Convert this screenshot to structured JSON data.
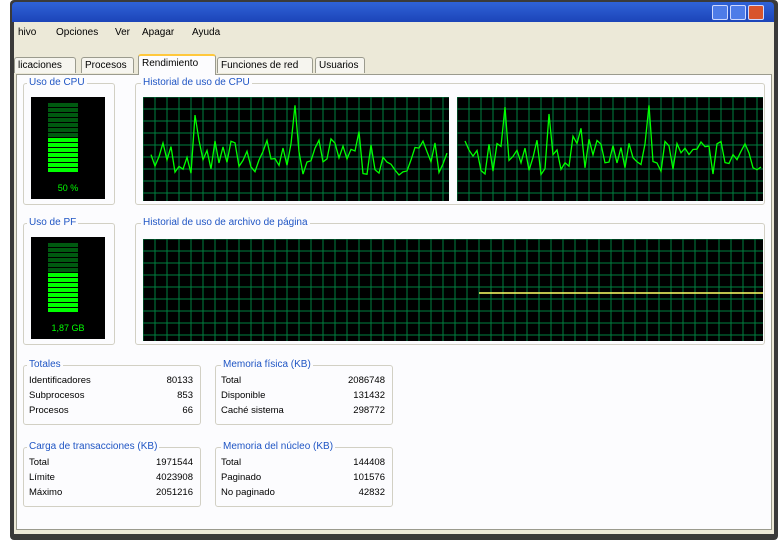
{
  "menu": [
    {
      "label": "hivo"
    },
    {
      "label": "Opciones"
    },
    {
      "label": "Ver"
    },
    {
      "label": "Apagar"
    },
    {
      "label": "Ayuda"
    }
  ],
  "tabs": [
    {
      "label": "licaciones",
      "active": false
    },
    {
      "label": "Procesos",
      "active": false
    },
    {
      "label": "Rendimiento",
      "active": true
    },
    {
      "label": "Funciones de red",
      "active": false
    },
    {
      "label": "Usuarios",
      "active": false
    }
  ],
  "cpu_usage": {
    "label": "Uso de CPU",
    "value": "50 %",
    "level": 0.5
  },
  "cpu_history": {
    "label": "Historial de uso de CPU"
  },
  "pf_usage": {
    "label": "Uso de PF",
    "value": "1,87 GB",
    "level": 0.55
  },
  "pf_history": {
    "label": "Historial de uso de archivo de página"
  },
  "totals": {
    "label": "Totales",
    "rows": [
      {
        "k": "Identificadores",
        "v": "80133"
      },
      {
        "k": "Subprocesos",
        "v": "853"
      },
      {
        "k": "Procesos",
        "v": "66"
      }
    ]
  },
  "physical_memory": {
    "label": "Memoria física (KB)",
    "rows": [
      {
        "k": "Total",
        "v": "2086748"
      },
      {
        "k": "Disponible",
        "v": "131432"
      },
      {
        "k": "Caché sistema",
        "v": "298772"
      }
    ]
  },
  "commit_charge": {
    "label": "Carga de transacciones (KB)",
    "rows": [
      {
        "k": "Total",
        "v": "1971544"
      },
      {
        "k": "Límite",
        "v": "4023908"
      },
      {
        "k": "Máximo",
        "v": "2051216"
      }
    ]
  },
  "kernel_memory": {
    "label": "Memoria del núcleo (KB)",
    "rows": [
      {
        "k": "Total",
        "v": "144408"
      },
      {
        "k": "Paginado",
        "v": "101576"
      },
      {
        "k": "No paginado",
        "v": "42832"
      }
    ]
  },
  "colors": {
    "graph_line": "#00ff00",
    "grid": "#008040",
    "pf_line": "#ffff66",
    "meter_on": "#00ff00",
    "meter_off": "#005a10"
  }
}
